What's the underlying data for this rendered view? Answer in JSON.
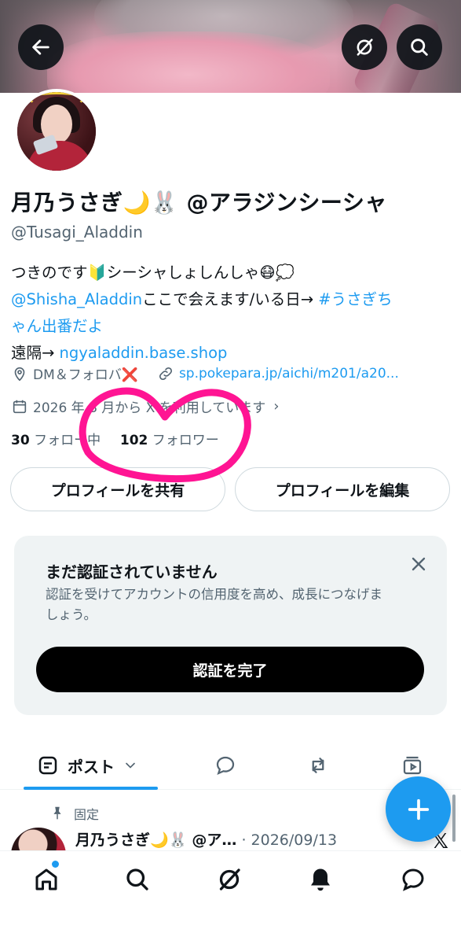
{
  "profile": {
    "display_name": "月乃うさぎ🌙🐰 @アラジンシーシャ",
    "handle": "@Tusagi_Aladdin",
    "bio_line1": "つきのです🔰シーシャしょしんしゃ😷💭",
    "bio_line2_mention": "@Shisha_Aladdin",
    "bio_line2_text": "ここで会えます/いる日→",
    "bio_line2_hashtag": "#うさぎち",
    "bio_line3_hashtag": "ゃん出番だよ",
    "bio_line4_text": "遠隔→",
    "bio_line4_link": "ngyaladdin.base.shop",
    "location": "DM＆フォロバ❌",
    "website": "sp.pokepara.jp/aichi/m201/a20...",
    "joined": "2026 年 8 月から X を利用しています",
    "following_count": "30",
    "following_label": "フォロー中",
    "followers_count": "102",
    "followers_label": "フォロワー"
  },
  "buttons": {
    "share_profile": "プロフィールを共有",
    "edit_profile": "プロフィールを編集"
  },
  "verify": {
    "title": "まだ認証されていません",
    "description": "認証を受けてアカウントの信用度を高め、成長につなげましょう。",
    "cta": "認証を完了"
  },
  "tabs": {
    "posts": "ポスト"
  },
  "pinned_post": {
    "pinned_label": "固定",
    "author": "月乃うさぎ🌙🐰",
    "author_suffix": "@ア…",
    "date": "· 2026/09/13"
  },
  "icons": {
    "back": "arrow-left-icon",
    "grok": "grok-icon",
    "search": "search-icon",
    "location": "location-pin-icon",
    "link": "link-icon",
    "calendar": "calendar-icon"
  },
  "colors": {
    "accent": "#1d9bf0",
    "scribble": "#ff1493"
  }
}
